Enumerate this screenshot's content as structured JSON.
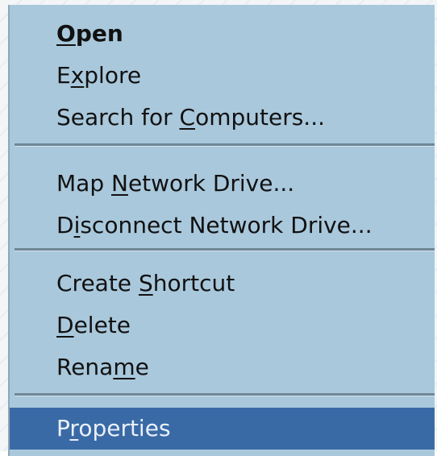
{
  "context_menu": {
    "items": [
      {
        "label": "Open",
        "pre": "",
        "key": "O",
        "post": "pen",
        "default": true
      },
      {
        "label": "Explore",
        "pre": "E",
        "key": "x",
        "post": "plore",
        "default": false
      },
      {
        "label": "Search for Computers...",
        "pre": "Search for ",
        "key": "C",
        "post": "omputers...",
        "default": false
      },
      {
        "label": "Map Network Drive...",
        "pre": "Map ",
        "key": "N",
        "post": "etwork Drive...",
        "default": false
      },
      {
        "label": "Disconnect Network Drive...",
        "pre": "D",
        "key": "i",
        "post": "sconnect Network Drive...",
        "default": false
      },
      {
        "label": "Create Shortcut",
        "pre": "Create ",
        "key": "S",
        "post": "hortcut",
        "default": false
      },
      {
        "label": "Delete",
        "pre": "",
        "key": "D",
        "post": "elete",
        "default": false
      },
      {
        "label": "Rename",
        "pre": "Rena",
        "key": "m",
        "post": "e",
        "default": false
      },
      {
        "label": "Properties",
        "pre": "P",
        "key": "r",
        "post": "operties",
        "default": false,
        "selected": true
      }
    ]
  }
}
